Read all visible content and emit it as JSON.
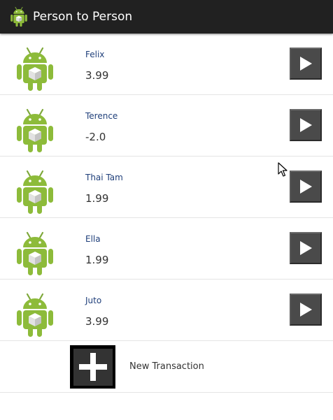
{
  "app_bar": {
    "title": "Person to Person",
    "icon": "android-robot-icon",
    "background": "#212121"
  },
  "transactions": [
    {
      "name": "Felix",
      "amount": "3.99"
    },
    {
      "name": "Terence",
      "amount": "-2.0"
    },
    {
      "name": "Thai Tam",
      "amount": "1.99"
    },
    {
      "name": "Ella",
      "amount": "1.99"
    },
    {
      "name": "Juto",
      "amount": "3.99"
    }
  ],
  "row_icons": {
    "avatar": "android-robot-icon",
    "action": "play-icon"
  },
  "new_transaction": {
    "label": "New Transaction",
    "icon": "plus-icon"
  },
  "colors": {
    "android_green": "#8dbb3a",
    "name_text": "#1f3f7a",
    "button_gray": "#4a4a4a"
  }
}
